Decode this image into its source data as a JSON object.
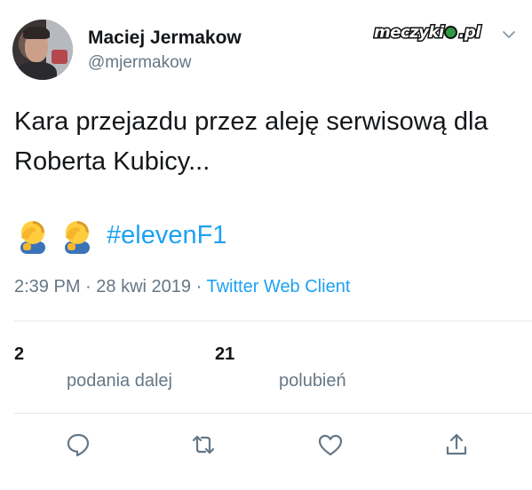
{
  "author": {
    "name": "Maciej Jermakow",
    "handle": "@mjermakow"
  },
  "brand": {
    "logo_text_left": "meczyki",
    "logo_text_right": ".pl"
  },
  "header_icons": {
    "menu": "chevron-down-icon"
  },
  "tweet": {
    "text": "Kara przejazdu przez aleję serwisową dla Roberta Kubicy...",
    "emojis": [
      "face-palm-emoji",
      "face-palm-emoji"
    ],
    "hashtag": "#elevenF1"
  },
  "meta": {
    "time": "2:39 PM",
    "sep1": "·",
    "date": "28 kwi 2019",
    "sep2": "·",
    "client": "Twitter Web Client"
  },
  "stats": {
    "retweets": {
      "count": "2",
      "label": "podania dalej"
    },
    "likes": {
      "count": "21",
      "label": "polubień"
    }
  },
  "actions": [
    "reply-icon",
    "retweet-icon",
    "like-icon",
    "share-icon"
  ],
  "colors": {
    "link": "#1da1f2",
    "secondary": "#657786",
    "text": "#14171a",
    "divider": "#e1e8ed"
  }
}
